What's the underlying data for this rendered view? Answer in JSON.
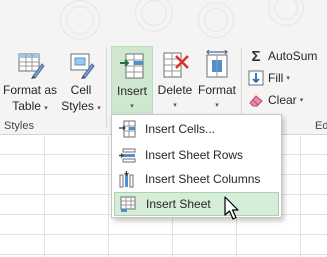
{
  "ribbon": {
    "format_as_table": {
      "line1": "Format as",
      "line2": "Table",
      "caret": "▾"
    },
    "cell_styles": {
      "line1": "Cell",
      "line2": "Styles",
      "caret": "▾"
    },
    "insert": {
      "label": "Insert",
      "caret": "▾"
    },
    "delete": {
      "label": "Delete",
      "caret": "▾"
    },
    "format": {
      "label": "Format",
      "caret": "▾"
    },
    "autosum": {
      "label": "AutoSum",
      "icon": "sigma-icon"
    },
    "fill": {
      "label": "Fill",
      "caret": "▾",
      "icon": "fill-down-arrow-icon"
    },
    "clear": {
      "label": "Clear",
      "caret": "▾",
      "icon": "eraser-icon"
    },
    "styles_group": "Styles",
    "right_group": "Ed"
  },
  "insert_menu": {
    "items": [
      {
        "label": "Insert Cells...",
        "icon": "insert-cells-icon"
      },
      {
        "label": "Insert Sheet Rows",
        "icon": "insert-rows-icon"
      },
      {
        "label": "Insert Sheet Columns",
        "icon": "insert-columns-icon"
      },
      {
        "label": "Insert Sheet",
        "icon": "insert-sheet-icon",
        "hovered": true
      }
    ]
  },
  "colors": {
    "insert_active": "#cfe6cf",
    "menu_hover": "#d5ecd8",
    "accent_green": "#217346",
    "delete_red": "#d9342b"
  }
}
